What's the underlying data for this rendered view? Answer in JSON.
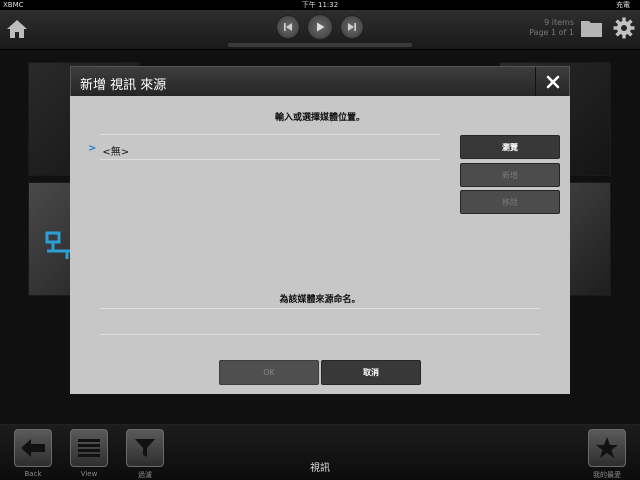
{
  "status_bar": {
    "carrier": "XBMC",
    "time": "下午 11:32",
    "battery": "充電"
  },
  "top_bar": {
    "items_count": "9 items",
    "page_info": "Page 1 of 1"
  },
  "dialog": {
    "title": "新增 視訊 來源",
    "path_prompt": "輸入或選擇媒體位置。",
    "paths": [
      {
        "marker": ">",
        "label": "<無>"
      }
    ],
    "browse_label": "瀏覽",
    "add_label": "新增",
    "remove_label": "移除",
    "name_prompt": "為該媒體來源命名。",
    "name_value": "",
    "ok_label": "OK",
    "cancel_label": "取消"
  },
  "bottom_bar": {
    "title": "視訊",
    "back_label": "Back",
    "view_label": "View",
    "filter_label": "過濾",
    "favourites_label": "我的最愛"
  },
  "colors": {
    "accent_blue": "#1f7fd6",
    "dialog_body": "#c7c7c7",
    "button_dark": "#383838"
  }
}
